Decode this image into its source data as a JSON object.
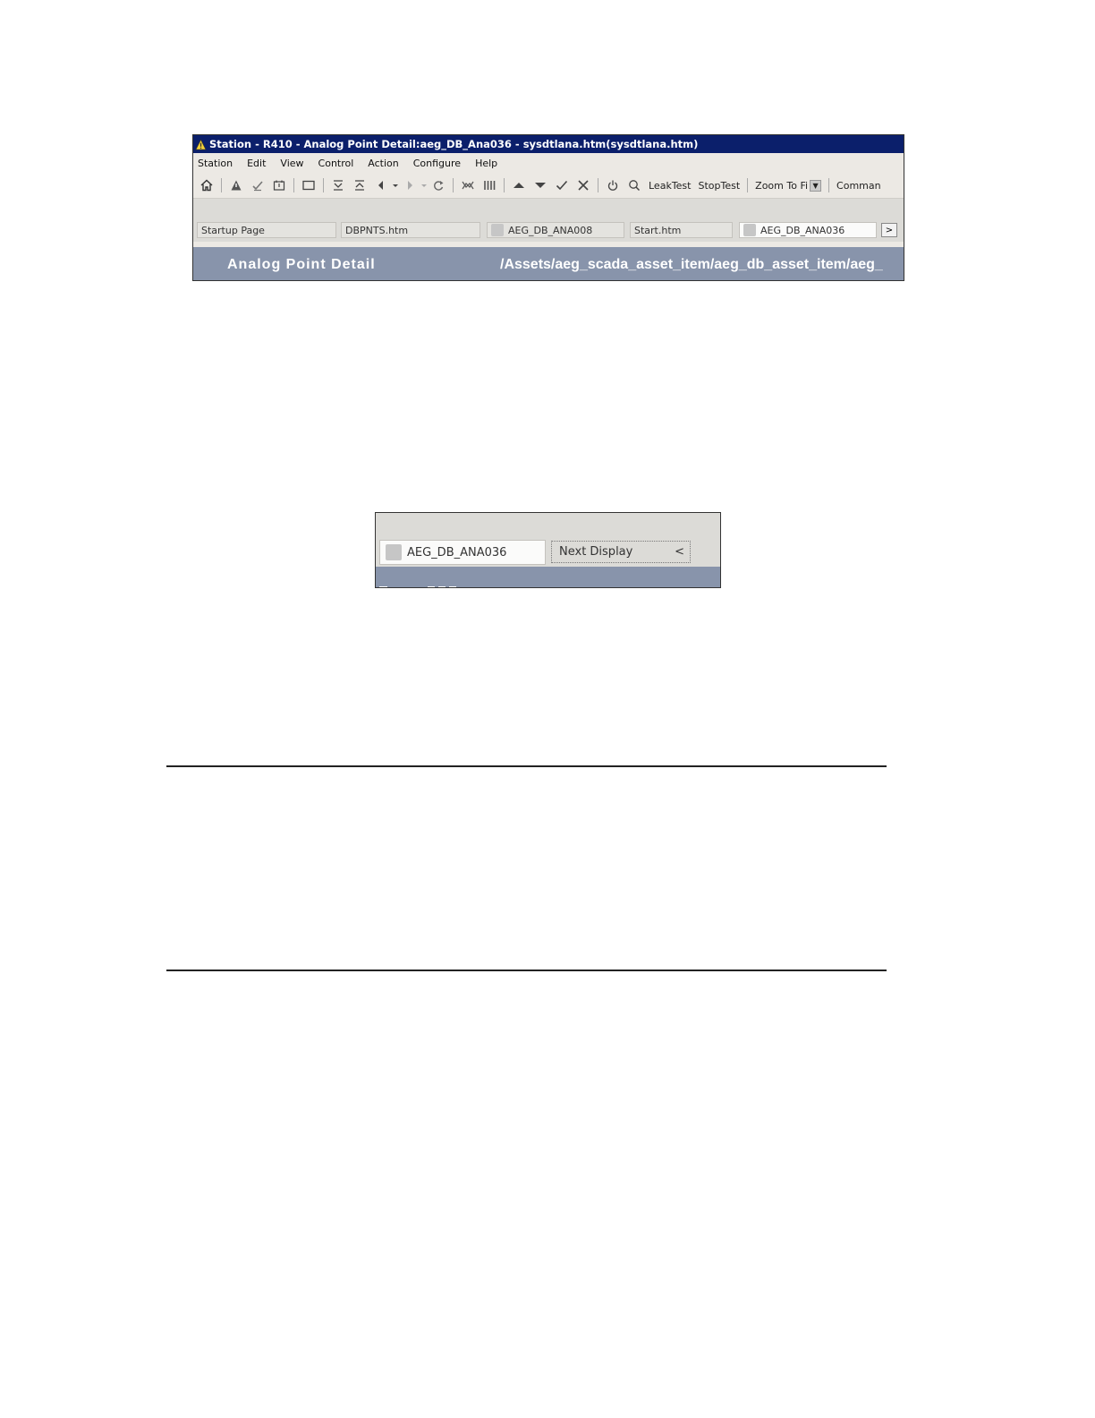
{
  "window": {
    "title": "Station - R410 - Analog Point Detail:aeg_DB_Ana036 - sysdtlana.htm(sysdtlana.htm)"
  },
  "menu": [
    "Station",
    "Edit",
    "View",
    "Control",
    "Action",
    "Configure",
    "Help"
  ],
  "toolbar": {
    "leaktest": "LeakTest",
    "stoptest": "StopTest",
    "zoom": "Zoom To Fi",
    "command": "Comman"
  },
  "tabs": [
    {
      "label": "Startup Page",
      "has_icon": false
    },
    {
      "label": "DBPNTS.htm",
      "has_icon": false
    },
    {
      "label": "AEG_DB_ANA008",
      "has_icon": true
    },
    {
      "label": "Start.htm",
      "has_icon": false
    },
    {
      "label": "AEG_DB_ANA036",
      "has_icon": true,
      "active": true
    }
  ],
  "tab_next_glyph": ">",
  "header": {
    "title": "Analog Point Detail",
    "path": "/Assets/aeg_scada_asset_item/aeg_db_asset_item/aeg_"
  },
  "zoomed": {
    "tab_label": "AEG_DB_ANA036",
    "next_display": "Next Display",
    "next_glyph": "<"
  }
}
